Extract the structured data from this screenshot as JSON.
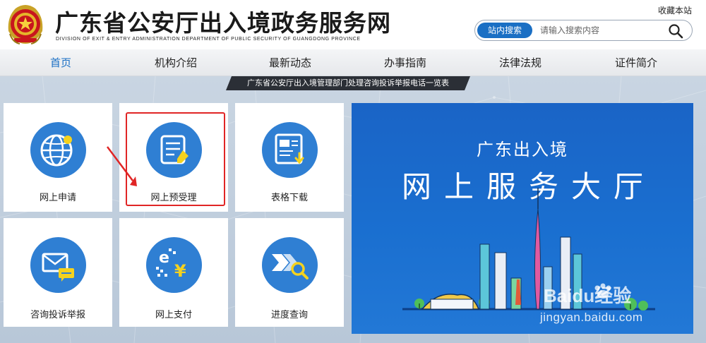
{
  "header": {
    "title": "广东省公安厅出入境政务服务网",
    "subtitle": "DIVISION OF EXIT & ENTRY ADMINISTRATION DEPARTMENT OF PUBLIC SECURITY OF GUANGDONG PROVINCE",
    "bookmark_label": "收藏本站"
  },
  "search": {
    "scope_label": "站内搜索",
    "placeholder": "请输入搜索内容",
    "icon": "search-icon"
  },
  "nav": {
    "items": [
      {
        "label": "首页",
        "active": true
      },
      {
        "label": "机构介绍",
        "active": false
      },
      {
        "label": "最新动态",
        "active": false
      },
      {
        "label": "办事指南",
        "active": false
      },
      {
        "label": "法律法规",
        "active": false
      },
      {
        "label": "证件简介",
        "active": false
      }
    ]
  },
  "notice": {
    "text": "广东省公安厅出入境管理部门处理咨询投诉举报电话一览表"
  },
  "tiles": [
    {
      "label": "网上申请",
      "icon": "globe-icon"
    },
    {
      "label": "网上预受理",
      "icon": "document-edit-icon"
    },
    {
      "label": "表格下载",
      "icon": "form-download-icon"
    },
    {
      "label": "咨询投诉举报",
      "icon": "message-icon"
    },
    {
      "label": "网上支付",
      "icon": "payment-icon"
    },
    {
      "label": "进度查询",
      "icon": "progress-search-icon"
    }
  ],
  "banner": {
    "subtitle": "广东出入境",
    "title": "网上服务大厅"
  },
  "watermark": {
    "logo_text": "Baidu经验",
    "url": "jingyan.baidu.com"
  },
  "colors": {
    "accent": "#1a6fc4",
    "tile_icon": "#2f7fd3",
    "banner": "#1a6fd0",
    "highlight": "#e02525"
  }
}
